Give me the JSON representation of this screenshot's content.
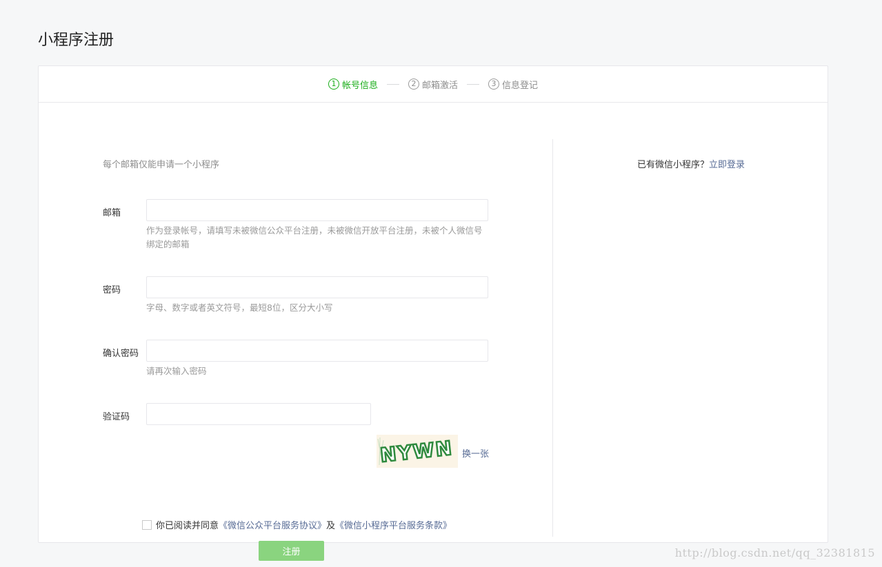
{
  "page_title": "小程序注册",
  "steps": [
    {
      "num": "1",
      "label": "帐号信息",
      "active": true
    },
    {
      "num": "2",
      "label": "邮箱激活",
      "active": false
    },
    {
      "num": "3",
      "label": "信息登记",
      "active": false
    }
  ],
  "form": {
    "tips": "每个邮箱仅能申请一个小程序",
    "email": {
      "label": "邮箱",
      "value": "",
      "hint": "作为登录帐号，请填写未被微信公众平台注册，未被微信开放平台注册，未被个人微信号绑定的邮箱"
    },
    "password": {
      "label": "密码",
      "value": "",
      "hint": "字母、数字或者英文符号，最短8位，区分大小写"
    },
    "confirm_password": {
      "label": "确认密码",
      "value": "",
      "hint": "请再次输入密码"
    },
    "captcha": {
      "label": "验证码",
      "value": "",
      "image_text": "NYWN",
      "refresh_label": "换一张"
    },
    "agreement": {
      "prefix": "你已阅读并同意",
      "link1": "《微信公众平台服务协议》",
      "and": "及",
      "link2": "《微信小程序平台服务条款》",
      "checked": false
    },
    "submit_label": "注册"
  },
  "side": {
    "question": "已有微信小程序？",
    "login_link": "立即登录"
  },
  "watermark": "http://blog.csdn.net/qq_32381815",
  "colors": {
    "accent": "#1aad19",
    "link": "#576b95",
    "button_disabled": "#8ad47f"
  }
}
